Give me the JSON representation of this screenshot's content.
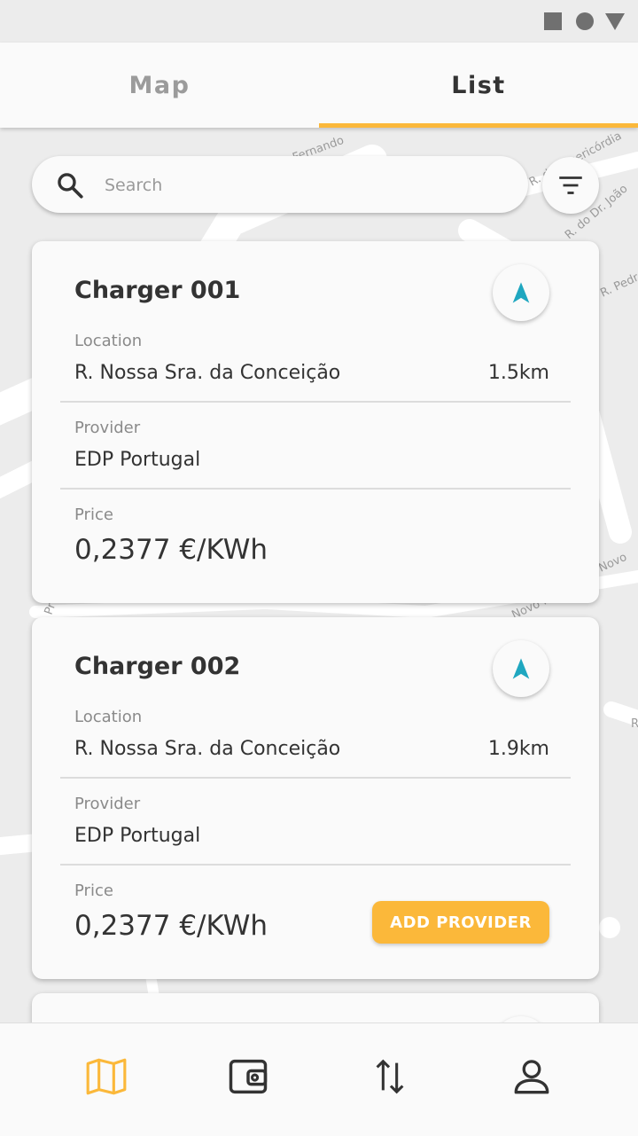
{
  "status_bar": {
    "icons": [
      "square-icon",
      "circle-icon",
      "triangle-icon"
    ]
  },
  "tabs": [
    {
      "label": "Map",
      "active": false
    },
    {
      "label": "List",
      "active": true
    }
  ],
  "search": {
    "placeholder": "Search",
    "value": ""
  },
  "map_streets": [
    "Fernando",
    "R. da Misericórdia",
    "R. do Dr. João",
    "R. Pedro N",
    "Novo",
    "Novo R.",
    "Pr",
    "R"
  ],
  "fields": {
    "location": "Location",
    "provider": "Provider",
    "price": "Price"
  },
  "chargers": [
    {
      "name": "Charger 001",
      "location": "R. Nossa Sra. da Conceição",
      "distance": "1.5km",
      "provider": "EDP Portugal",
      "price": "0,2377 €/KWh",
      "action": ""
    },
    {
      "name": "Charger 002",
      "location": "R. Nossa Sra. da Conceição",
      "distance": "1.9km",
      "provider": "EDP Portugal",
      "price": "0,2377 €/KWh",
      "action": "ADD PROVIDER"
    }
  ],
  "bottom_nav": [
    {
      "icon": "map-icon",
      "active": true
    },
    {
      "icon": "wallet-icon",
      "active": false
    },
    {
      "icon": "transfer-icon",
      "active": false
    },
    {
      "icon": "profile-icon",
      "active": false
    }
  ],
  "colors": {
    "accent": "#fbb83a",
    "navigation": "#1fa7c0",
    "text": "#333333",
    "muted": "#8a8a8a"
  }
}
